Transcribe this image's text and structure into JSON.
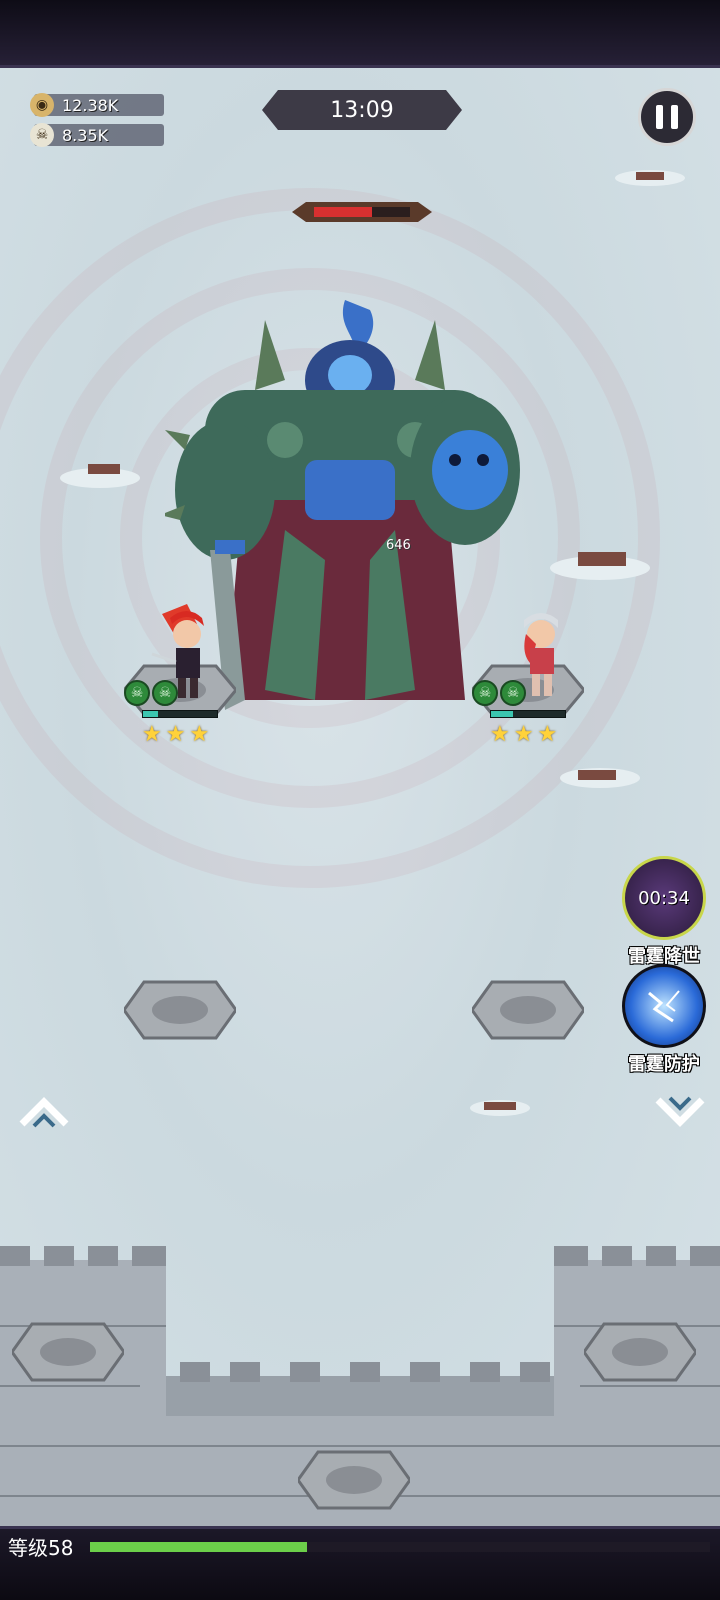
{
  "resources": {
    "gold": {
      "icon": "coin-icon",
      "value": "12.38K"
    },
    "kills": {
      "icon": "skull-icon",
      "value": "8.35K"
    }
  },
  "timer": "13:09",
  "pause_icon": "pause-icon",
  "boss": {
    "hp_fraction": 0.6,
    "damage_number": "646"
  },
  "heroes": [
    {
      "name_icon": "red-haired-swordswoman",
      "hp_fraction": 0.2,
      "stars": 3,
      "buff_icons": [
        "skull-buff-icon",
        "skull-buff-icon"
      ]
    },
    {
      "name_icon": "armored-knight-girl",
      "hp_fraction": 0.3,
      "stars": 3,
      "buff_icons": [
        "skull-buff-icon",
        "skull-buff-icon"
      ]
    }
  ],
  "skills": [
    {
      "label": "雷霆降世",
      "cooldown": "00:34",
      "icon": "dark-vortex-icon"
    },
    {
      "label": "雷霆防护",
      "cooldown": "",
      "icon": "lightning-shield-icon"
    }
  ],
  "nav": {
    "up_icon": "chevron-up-icon",
    "down_icon": "chevron-down-icon"
  },
  "player": {
    "level_label": "等级58",
    "xp_fraction": 0.35
  },
  "colors": {
    "xp": "#6ccf4a",
    "boss_hp": "#d83030",
    "hero_hp": "#3cc6b0",
    "star": "#ffd23a"
  }
}
